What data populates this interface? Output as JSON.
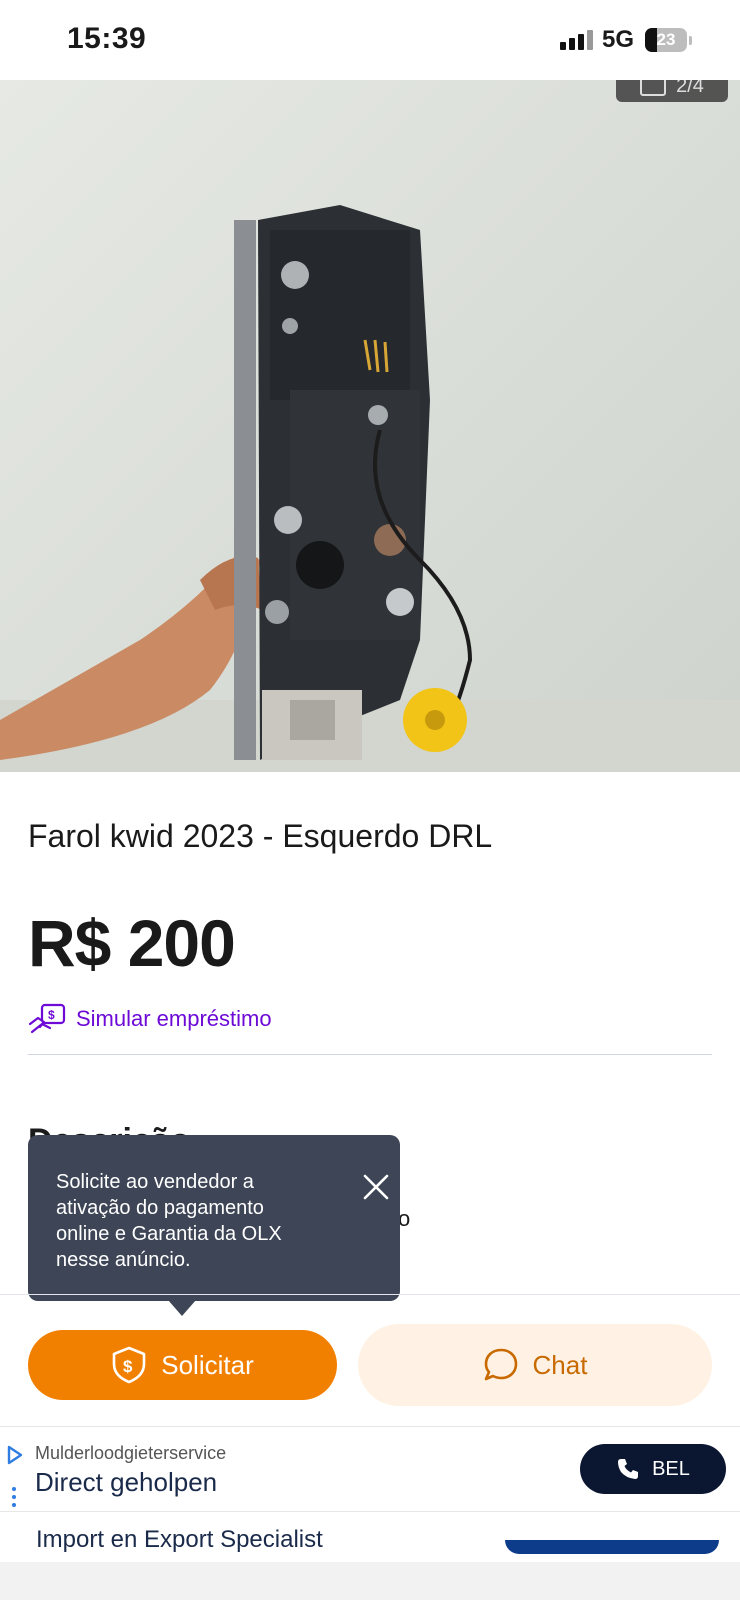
{
  "status_bar": {
    "time": "15:39",
    "network": "5G",
    "battery": "23"
  },
  "gallery": {
    "counter": "2/4"
  },
  "listing": {
    "title": "Farol kwid 2023 - Esquerdo DRL",
    "price": "R$ 200",
    "loan_link": "Simular empréstimo",
    "description_heading": "Descrição",
    "description_partial": "o"
  },
  "tooltip": {
    "text": "Solicite ao vendedor a ativação do pagamento online e Garantia da OLX nesse anúncio."
  },
  "actions": {
    "solicitar_label": "Solicitar",
    "chat_label": "Chat"
  },
  "ad": {
    "sponsor": "Mulderloodgieterservice",
    "headline": "Direct geholpen",
    "cta_label": "BEL",
    "next_headline": "Import en Export Specialist"
  },
  "colors": {
    "accent_orange": "#f28000",
    "link_purple": "#6e0ad6",
    "tooltip_bg": "#3d4556"
  }
}
